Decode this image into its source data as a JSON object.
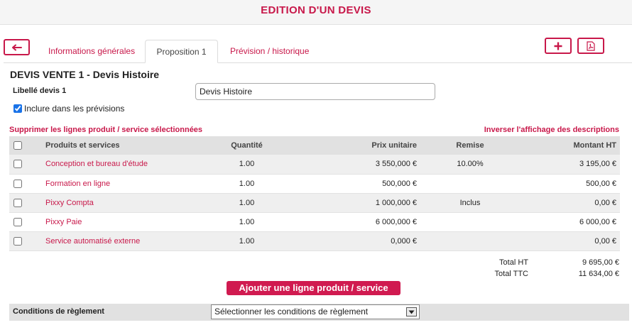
{
  "header": {
    "title": "EDITION D'UN DEVIS"
  },
  "toolbar": {
    "back_icon": "arrow-left-icon",
    "add_icon": "plus-icon",
    "pdf_icon": "pdf-file-icon"
  },
  "tabs": [
    {
      "label": "Informations générales",
      "active": false
    },
    {
      "label": "Proposition 1",
      "active": true
    },
    {
      "label": "Prévision / historique",
      "active": false
    }
  ],
  "devis": {
    "title": "DEVIS VENTE 1 - Devis Histoire",
    "libelle_label": "Libellé devis 1",
    "libelle_value": "Devis Histoire",
    "include_label": "Inclure dans les prévisions",
    "include_checked": true
  },
  "actions": {
    "delete_selected": "Supprimer les lignes produit / service sélectionnées",
    "toggle_descriptions": "Inverser l'affichage des descriptions",
    "add_line": "Ajouter une ligne produit / service"
  },
  "table": {
    "headers": {
      "name": "Produits et services",
      "quantity": "Quantité",
      "unit_price": "Prix unitaire",
      "discount": "Remise",
      "amount": "Montant HT"
    },
    "rows": [
      {
        "name": "Conception et bureau d'étude",
        "quantity": "1.00",
        "unit_price": "3 550,000 €",
        "discount": "10.00%",
        "amount": "3 195,00 €"
      },
      {
        "name": "Formation en ligne",
        "quantity": "1.00",
        "unit_price": "500,000 €",
        "discount": "",
        "amount": "500,00 €"
      },
      {
        "name": "Pixxy Compta",
        "quantity": "1.00",
        "unit_price": "1 000,000 €",
        "discount": "Inclus",
        "amount": "0,00 €"
      },
      {
        "name": "Pixxy Paie",
        "quantity": "1.00",
        "unit_price": "6 000,000 €",
        "discount": "",
        "amount": "6 000,00 €"
      },
      {
        "name": "Service automatisé externe",
        "quantity": "1.00",
        "unit_price": "0,000 €",
        "discount": "",
        "amount": "0,00 €"
      }
    ]
  },
  "totals": {
    "ht_label": "Total HT",
    "ht_value": "9 695,00 €",
    "ttc_label": "Total TTC",
    "ttc_value": "11 634,00 €"
  },
  "conditions": {
    "label": "Conditions de règlement",
    "select_value": "Sélectionner les conditions de règlement"
  },
  "colors": {
    "accent": "#c8184a",
    "button_fill": "#d01a50",
    "row_alt": "#efefef",
    "header_bg": "#e1e1e1"
  }
}
